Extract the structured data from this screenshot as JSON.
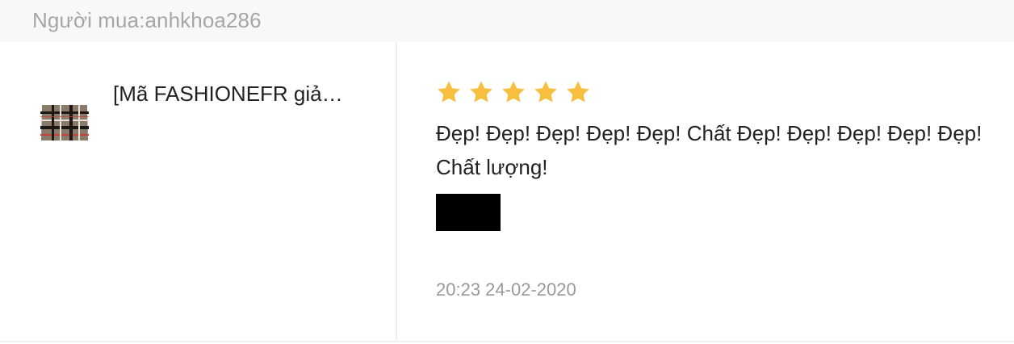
{
  "buyer": {
    "label": "Người mua:anhkhoa286"
  },
  "product": {
    "name": "[Mã FASHIONEFR giả…",
    "thumbnail_icon": "plaid-bag-thumbnail"
  },
  "review": {
    "rating": 5,
    "rating_max": 5,
    "star_color": "#f6bf3d",
    "comment": "Đẹp! Đẹp! Đẹp! Đẹp! Đẹp! Chất Đẹp! Đẹp! Đẹp! Đẹp! Đẹp! Chất lượng!",
    "timestamp": "20:23 24-02-2020"
  }
}
